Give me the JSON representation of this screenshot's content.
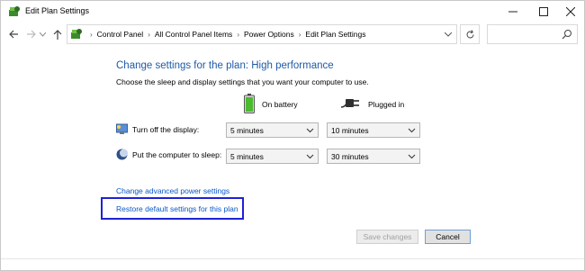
{
  "window": {
    "title": "Edit Plan Settings",
    "controls": {
      "minimize": "minimize",
      "maximize": "maximize",
      "close": "close"
    }
  },
  "nav": {
    "breadcrumbs": [
      "Control Panel",
      "All Control Panel Items",
      "Power Options",
      "Edit Plan Settings"
    ],
    "search_placeholder": ""
  },
  "main": {
    "heading": "Change settings for the plan: High performance",
    "subtext": "Choose the sleep and display settings that you want your computer to use.",
    "columns": {
      "battery": "On battery",
      "plugged": "Plugged in"
    },
    "rows": [
      {
        "label": "Turn off the display:",
        "battery": "5 minutes",
        "plugged": "10 minutes"
      },
      {
        "label": "Put the computer to sleep:",
        "battery": "5 minutes",
        "plugged": "30 minutes"
      }
    ],
    "links": {
      "advanced": "Change advanced power settings",
      "restore": "Restore default settings for this plan"
    },
    "buttons": {
      "save": "Save changes",
      "cancel": "Cancel"
    }
  },
  "colors": {
    "heading": "#1e5aa8",
    "link": "#0a58ca",
    "highlight_box": "#1e22d6"
  }
}
